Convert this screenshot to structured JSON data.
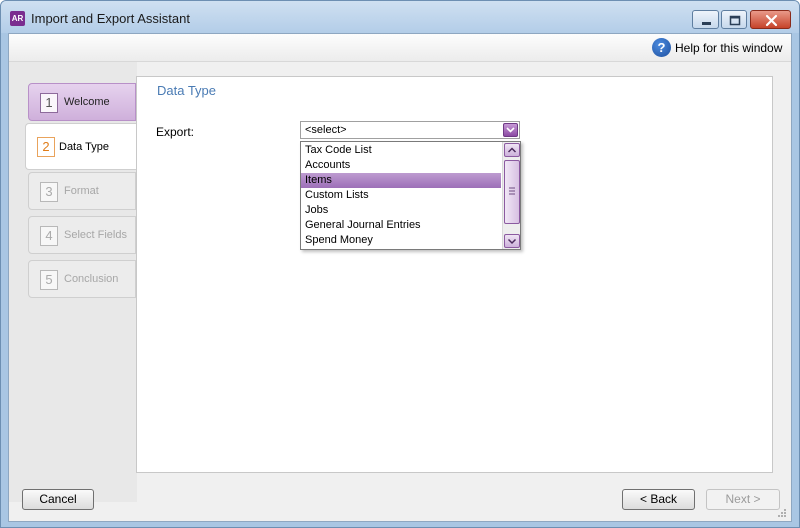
{
  "window": {
    "icon_text": "AR",
    "title": "Import and Export Assistant"
  },
  "help": {
    "icon_glyph": "?",
    "label": "Help for this window"
  },
  "steps": [
    {
      "num": "1",
      "label": "Welcome",
      "state": "done"
    },
    {
      "num": "2",
      "label": "Data Type",
      "state": "active"
    },
    {
      "num": "3",
      "label": "Format",
      "state": "disabled"
    },
    {
      "num": "4",
      "label": "Select Fields",
      "state": "disabled"
    },
    {
      "num": "5",
      "label": "Conclusion",
      "state": "disabled"
    }
  ],
  "content": {
    "title": "Data Type",
    "export_label": "Export:",
    "export_value": "<select>",
    "options": [
      "Tax Code List",
      "Accounts",
      "Items",
      "Custom Lists",
      "Jobs",
      "General Journal Entries",
      "Spend Money"
    ],
    "highlighted_option": "Items"
  },
  "footer": {
    "cancel": "Cancel",
    "back": "< Back",
    "next": "Next >"
  },
  "colors": {
    "accent_purple": "#9d6fb8",
    "title_blue": "#4a7bb4",
    "active_step_orange": "#e07d1a"
  },
  "icons": {
    "help": "help-icon",
    "dropdown": "chevron-down-icon",
    "scroll_up": "chevron-up-icon",
    "scroll_down": "chevron-down-icon"
  }
}
